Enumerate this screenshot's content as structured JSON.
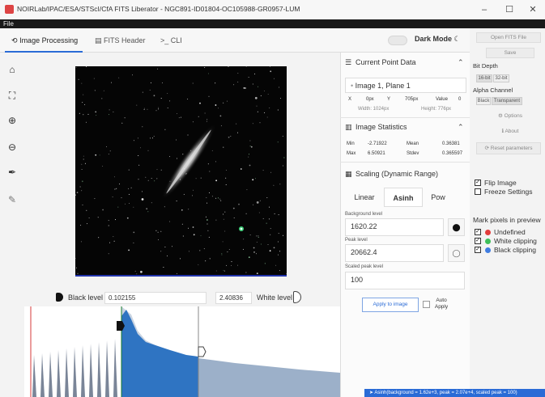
{
  "window": {
    "title": "NOIRLab/IPAC/ESA/STScI/CfA FITS Liberator - NGC891-ID01804-OC105988-GR0957-LUM",
    "minimize": "–",
    "maximize": "☐",
    "close": "✕"
  },
  "menu": {
    "file": "File"
  },
  "tabs": [
    {
      "label": "Image Processing",
      "icon": "refresh-icon"
    },
    {
      "label": "FITS Header",
      "icon": "table-icon"
    },
    {
      "label": "CLI",
      "icon": "terminal-icon"
    }
  ],
  "dark_mode": {
    "label": "Dark Mode",
    "icon": "moon-icon"
  },
  "toolbar": {
    "icons": [
      "home-icon",
      "fit-icon",
      "zoom-in-icon",
      "zoom-out-icon",
      "eyedropper-black-icon",
      "eyedropper-white-icon"
    ]
  },
  "levels": {
    "black_label": "Black level",
    "black_value": "0.102155",
    "white_value": "2.40836",
    "white_label": "White level"
  },
  "current_point": {
    "title": "Current Point Data",
    "image_label": "Image 1, Plane 1",
    "x_label": "X",
    "x_value": "0px",
    "y_label": "Y",
    "y_value": "705px",
    "value_label": "Value",
    "value_value": "0",
    "width_text": "Width: 1024px",
    "height_text": "Height: 776px"
  },
  "stats": {
    "title": "Image Statistics",
    "min_label": "Min",
    "min_value": "-2.71922",
    "mean_label": "Mean",
    "mean_value": "0.36381",
    "max_label": "Max",
    "max_value": "6.50921",
    "stdev_label": "Stdev",
    "stdev_value": "0.365597"
  },
  "scaling": {
    "title": "Scaling (Dynamic Range)",
    "tabs": [
      "Linear",
      "Asinh",
      "Pow"
    ],
    "active_tab": "Asinh",
    "background_label": "Background level",
    "background_value": "1620.22",
    "peak_label": "Peak level",
    "peak_value": "20662.4",
    "scaled_peak_label": "Scaled peak level",
    "scaled_peak_value": "100",
    "apply_button": "Apply to image",
    "auto_apply_label": "Auto Apply"
  },
  "sidebar": {
    "open_button": "Open FITS File",
    "save_button": "Save",
    "bit_depth_label": "Bit Depth",
    "bit_depth_options": [
      "16-bit",
      "32-bit"
    ],
    "alpha_label": "Alpha Channel",
    "alpha_options": [
      "Black",
      "Transparent"
    ],
    "options_button": "Options",
    "about_button": "About",
    "reset_button": "Reset parameters",
    "flip_image_label": "Flip Image",
    "flip_image_checked": true,
    "freeze_label": "Freeze Settings",
    "freeze_checked": false,
    "mark_pixels_title": "Mark pixels in preview",
    "mark_items": [
      {
        "label": "Undefined",
        "color": "#e23c3c",
        "checked": true
      },
      {
        "label": "White clipping",
        "color": "#3fbf5a",
        "checked": true
      },
      {
        "label": "Black clipping",
        "color": "#3f7ce0",
        "checked": true
      }
    ]
  },
  "status": {
    "text": "Asinh(background = 1.62e+3, peak = 2.07e+4, scaled peak = 100)"
  }
}
